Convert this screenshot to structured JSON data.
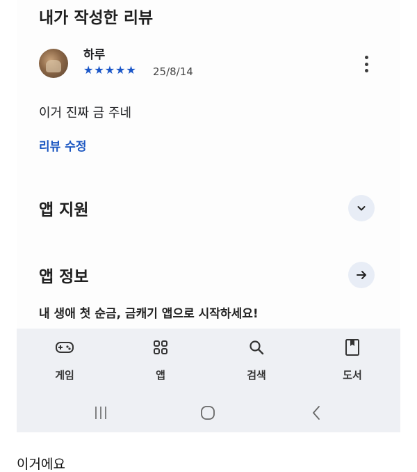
{
  "reviews": {
    "title": "내가 작성한 리뷰",
    "reviewer": "하루",
    "rating": 5,
    "stars": "★★★★★",
    "date": "25/8/14",
    "text": "이거 진짜 금 주네",
    "edit_label": "리뷰 수정"
  },
  "support": {
    "title": "앱 지원"
  },
  "app_info": {
    "title": "앱 정보"
  },
  "promo": "내 생애 첫 순금, 금캐기 앱으로 시작하세요!",
  "bottom_nav": [
    {
      "label": "게임",
      "icon": "gamepad-icon"
    },
    {
      "label": "앱",
      "icon": "apps-grid-icon"
    },
    {
      "label": "검색",
      "icon": "search-icon"
    },
    {
      "label": "도서",
      "icon": "book-icon"
    }
  ],
  "system_nav": [
    "recent-apps-icon",
    "home-icon",
    "back-icon"
  ],
  "caption": "이거에요",
  "colors": {
    "accent_blue": "#1b56c1",
    "star_blue": "#1a56c8",
    "nav_bg": "#eef0f4",
    "round_btn_bg": "#e8edf6"
  }
}
